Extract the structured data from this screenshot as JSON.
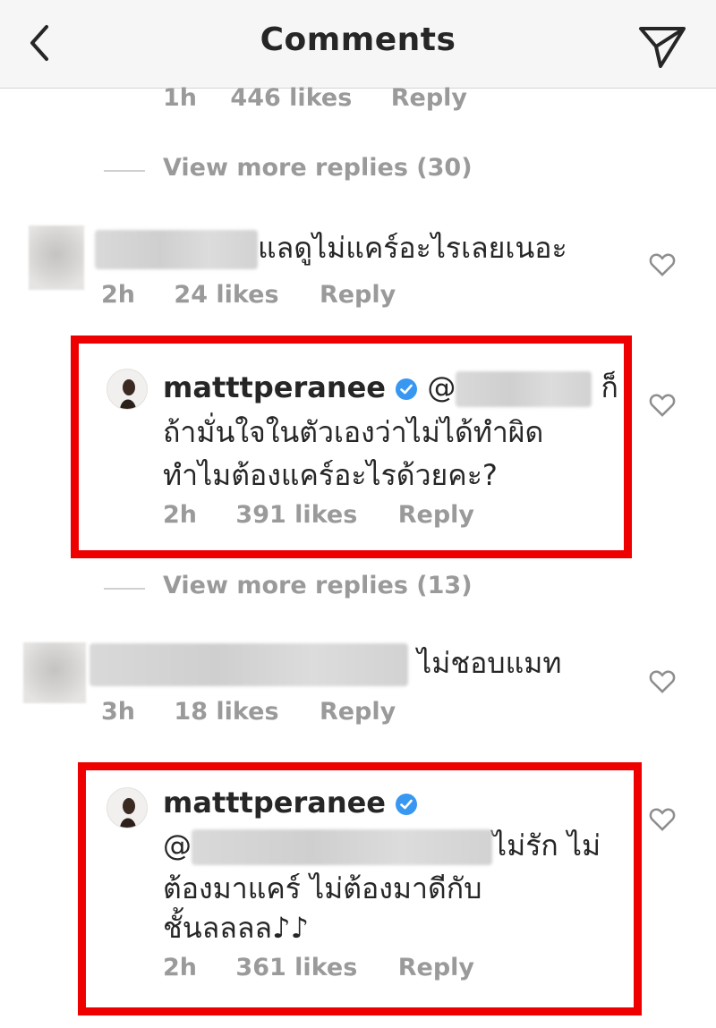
{
  "header": {
    "title": "Comments",
    "back_icon": "chevron-left-icon",
    "send_icon": "paper-plane-icon"
  },
  "colors": {
    "highlight_border": "#ee0000",
    "verified_blue": "#3897f0",
    "meta_gray": "#9a9a9a"
  },
  "top_reply_meta": {
    "time": "1h",
    "likes": "446 likes",
    "reply": "Reply"
  },
  "view_more_1": "View more replies (30)",
  "comment1": {
    "text": "แลดูไม่แคร์อะไรเลยเนอะ",
    "time": "2h",
    "likes": "24 likes",
    "reply": "Reply"
  },
  "reply1": {
    "username": "matttperanee",
    "mention_prefix": "@",
    "line1_suffix": "ก็",
    "line2": "ถ้ามั่นใจในตัวเองว่าไม่ได้ทำผิด",
    "line3": "ทำไมต้องแคร์อะไรด้วยคะ?",
    "time": "2h",
    "likes": "391 likes",
    "reply": "Reply"
  },
  "view_more_2": "View more replies (13)",
  "comment2": {
    "text": "ไม่ชอบแมท",
    "time": "3h",
    "likes": "18 likes",
    "reply": "Reply"
  },
  "reply2": {
    "username": "matttperanee",
    "mention_prefix": "@",
    "line1_suffix": "ไม่รัก ไม่",
    "line2": "ต้องมาแคร์ ไม่ต้องมาดีกับ",
    "line3": "ชั้นลลลล♪♪",
    "time": "2h",
    "likes": "361 likes",
    "reply": "Reply"
  }
}
